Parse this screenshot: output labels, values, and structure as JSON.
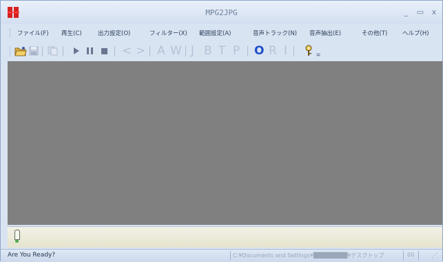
{
  "window": {
    "title": "MPG2JPG",
    "minimize": "_",
    "maximize": "▭",
    "close": "x"
  },
  "menu": {
    "items": [
      {
        "label": "ファイル(F)"
      },
      {
        "label": "再生(C)"
      },
      {
        "label": "出力設定(O)"
      },
      {
        "label": "フィルター(X)"
      },
      {
        "label": "範囲設定(A)"
      },
      {
        "label": "音声トラック(N)"
      },
      {
        "label": "音声抽出(E)"
      },
      {
        "label": "その他(T)"
      },
      {
        "label": "ヘルプ(H)"
      }
    ]
  },
  "toolbar": {
    "prev_glyph": "<",
    "next_glyph": ">",
    "letters": [
      "A",
      "W",
      "J",
      "B",
      "T",
      "P",
      "O",
      "R",
      "I"
    ]
  },
  "status": {
    "message": "Are You Ready?",
    "path": "C:¥Documents and Settings¥████████¥デスクトップ",
    "number": "00"
  }
}
